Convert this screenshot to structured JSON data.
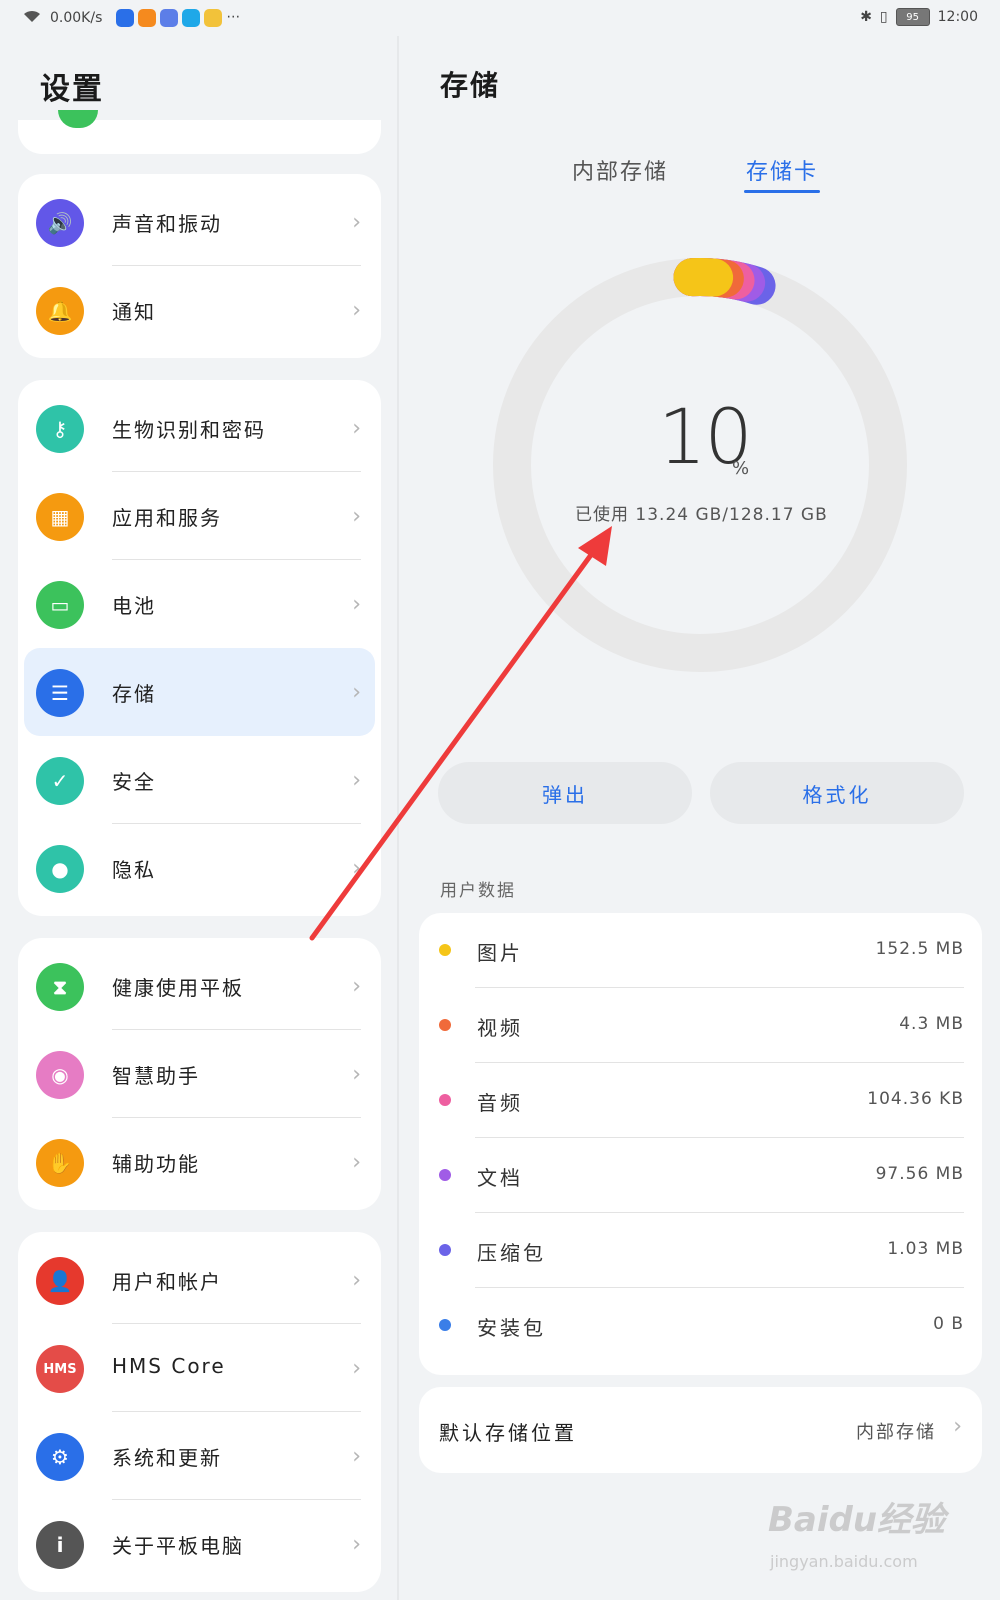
{
  "status_bar": {
    "network_speed": "0.00K/s",
    "battery": "95",
    "time": "12:00"
  },
  "settings": {
    "title": "设置",
    "groups": [
      [
        {
          "label": "声音和振动",
          "icon": "speaker-icon",
          "color": "#6257e8",
          "glyph": "🔊"
        },
        {
          "label": "通知",
          "icon": "bell-icon",
          "color": "#f59a10",
          "glyph": "🔔"
        }
      ],
      [
        {
          "label": "生物识别和密码",
          "icon": "key-icon",
          "color": "#2fc3a8",
          "glyph": "⚷"
        },
        {
          "label": "应用和服务",
          "icon": "apps-icon",
          "color": "#f59a10",
          "glyph": "▦"
        },
        {
          "label": "电池",
          "icon": "battery-icon",
          "color": "#3cc25c",
          "glyph": "▭"
        },
        {
          "label": "存储",
          "icon": "storage-icon",
          "color": "#2a6fe8",
          "glyph": "☰",
          "selected": true
        },
        {
          "label": "安全",
          "icon": "shield-check-icon",
          "color": "#2fc3a8",
          "glyph": "✓"
        },
        {
          "label": "隐私",
          "icon": "privacy-shield-icon",
          "color": "#2fc3a8",
          "glyph": "●"
        }
      ],
      [
        {
          "label": "健康使用平板",
          "icon": "hourglass-icon",
          "color": "#3cc25c",
          "glyph": "⧗"
        },
        {
          "label": "智慧助手",
          "icon": "assistant-icon",
          "color": "#e67cc4",
          "glyph": "◉"
        },
        {
          "label": "辅助功能",
          "icon": "hand-icon",
          "color": "#f59a10",
          "glyph": "✋"
        }
      ],
      [
        {
          "label": "用户和帐户",
          "icon": "user-icon",
          "color": "#e6392d",
          "glyph": "👤"
        },
        {
          "label": "HMS Core",
          "icon": "hms-icon",
          "color": "#e44c48",
          "glyph": "HMS"
        },
        {
          "label": "系统和更新",
          "icon": "gear-icon",
          "color": "#2a6fe8",
          "glyph": "⚙"
        },
        {
          "label": "关于平板电脑",
          "icon": "info-icon",
          "color": "#555555",
          "glyph": "i"
        }
      ]
    ]
  },
  "storage": {
    "title": "存储",
    "tabs": [
      "内部存储",
      "存储卡"
    ],
    "active_tab": 1,
    "percent_value": "10",
    "percent_sign": "%",
    "percent_used": 0.1,
    "used_text": "已使用 13.24 GB/128.17 GB",
    "eject_label": "弹出",
    "format_label": "格式化",
    "user_data_label": "用户数据",
    "items": [
      {
        "name": "图片",
        "size": "152.5 MB",
        "color": "#f5c518"
      },
      {
        "name": "视频",
        "size": "4.3 MB",
        "color": "#f06a3a"
      },
      {
        "name": "音频",
        "size": "104.36 KB",
        "color": "#ee5fa0"
      },
      {
        "name": "文档",
        "size": "97.56 MB",
        "color": "#a05ce6"
      },
      {
        "name": "压缩包",
        "size": "1.03 MB",
        "color": "#6b63e8"
      },
      {
        "name": "安装包",
        "size": "0 B",
        "color": "#3a7ee8"
      }
    ],
    "default_location_label": "默认存储位置",
    "default_location_value": "内部存储"
  },
  "watermark": {
    "brand": "Baidu经验",
    "url": "jingyan.baidu.com"
  },
  "colors": {
    "accent": "#2a6fe8",
    "annotation_arrow": "#ee3b3b",
    "selected_bg": "#e6f0fd"
  }
}
